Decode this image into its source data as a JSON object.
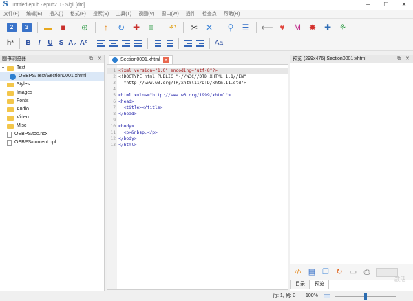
{
  "window": {
    "title": "untitled.epub - epub2.0 - Sigil [dtd]",
    "minimize": "─",
    "maximize": "☐",
    "close": "✕"
  },
  "menu": [
    "文件(F)",
    "编辑(E)",
    "插入(I)",
    "格式(F)",
    "搜索(S)",
    "工具(T)",
    "视图(V)",
    "窗口(W)",
    "插件",
    "检查点",
    "帮助(H)"
  ],
  "toolbar2": {
    "heading": "h*",
    "bold": "B",
    "italic": "I",
    "underline": "U",
    "strike": "S",
    "sub": "A₂",
    "sup": "A²",
    "style": "Aa"
  },
  "book_browser": {
    "title": "图书浏览器",
    "items": [
      {
        "label": "Text",
        "kind": "folder"
      },
      {
        "label": "OEBPS/Text/Section0001.xhtml",
        "kind": "file-html"
      },
      {
        "label": "Styles",
        "kind": "folder"
      },
      {
        "label": "Images",
        "kind": "folder"
      },
      {
        "label": "Fonts",
        "kind": "folder"
      },
      {
        "label": "Audio",
        "kind": "folder"
      },
      {
        "label": "Video",
        "kind": "folder"
      },
      {
        "label": "Misc",
        "kind": "folder"
      },
      {
        "label": "OEBPS/toc.ncx",
        "kind": "file"
      },
      {
        "label": "OEBPS/content.opf",
        "kind": "file"
      }
    ]
  },
  "editor": {
    "tab": "Section0001.xhtml",
    "lines": [
      {
        "n": "1",
        "text": "<?xml version=\"1.0\" encoding=\"utf-8\"?>"
      },
      {
        "n": "2",
        "text": "<!DOCTYPE html PUBLIC \"-//W3C//DTD XHTML 1.1//EN\""
      },
      {
        "n": "3",
        "text": "  \"http://www.w3.org/TR/xhtml11/DTD/xhtml11.dtd\">"
      },
      {
        "n": "4",
        "text": ""
      },
      {
        "n": "5",
        "text": "<html xmlns=\"http://www.w3.org/1999/xhtml\">"
      },
      {
        "n": "6",
        "text": "<head>"
      },
      {
        "n": "7",
        "text": "  <title></title>"
      },
      {
        "n": "8",
        "text": "</head>"
      },
      {
        "n": "9",
        "text": ""
      },
      {
        "n": "10",
        "text": "<body>"
      },
      {
        "n": "11",
        "text": "  <p>&nbsp;</p>"
      },
      {
        "n": "12",
        "text": "</body>"
      },
      {
        "n": "13",
        "text": "</html>"
      }
    ]
  },
  "preview": {
    "title": "预览 (299x476) Section0001.xhtml",
    "tabs": [
      "目录",
      "预览"
    ]
  },
  "status": {
    "position": "行: 1, 列: 3",
    "zoom": "100%",
    "zoom_level": 0.5
  },
  "watermark": "激活"
}
